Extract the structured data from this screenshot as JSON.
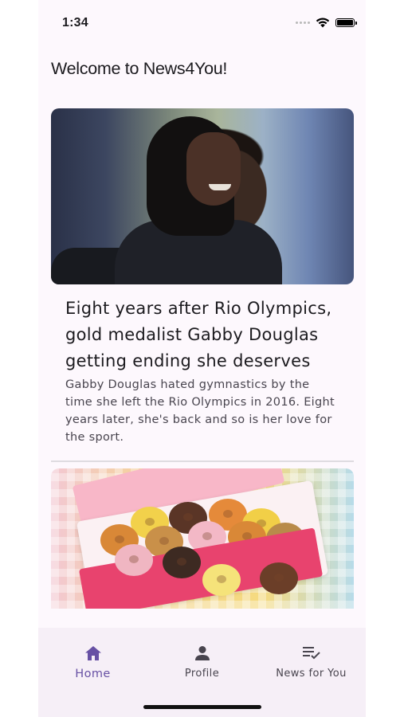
{
  "status_bar": {
    "time": "1:34",
    "icons": [
      "signal-dots-icon",
      "wifi-icon",
      "battery-icon"
    ]
  },
  "app": {
    "title": "Welcome to News4You!",
    "accent_color": "#6750a4",
    "background_color": "#fdf8fd"
  },
  "articles": [
    {
      "headline": "Eight years after Rio Olympics, gold medalist Gabby Douglas getting ending she deserves",
      "summary": "Gabby Douglas hated gymnastics by the time she left the Rio Olympics in 2016. Eight years later, she's back and so is her love for the sport."
    },
    {
      "headline": "",
      "summary": ""
    }
  ],
  "bottom_nav": {
    "items": [
      {
        "label": "Home",
        "icon": "home-icon",
        "active": true
      },
      {
        "label": "Profile",
        "icon": "person-icon",
        "active": false
      },
      {
        "label": "News for You",
        "icon": "playlist-check-icon",
        "active": false
      }
    ]
  }
}
